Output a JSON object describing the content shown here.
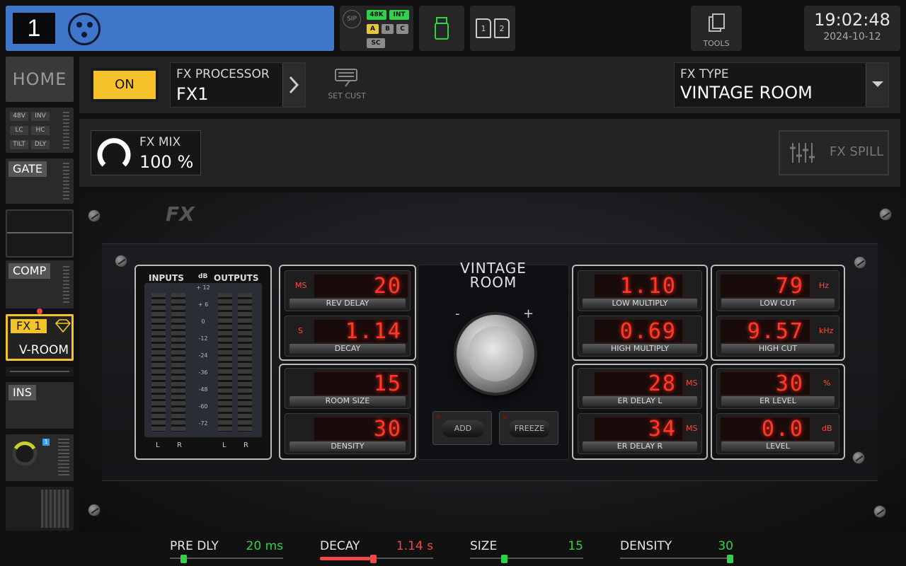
{
  "top": {
    "channel_number": "1",
    "sip_label": "SIP",
    "chips": {
      "rate": "48K",
      "clock": "INT",
      "a": "A",
      "b": "B",
      "c": "C",
      "sc": "SC"
    },
    "card1": "1",
    "card2": "2",
    "tools_label": "TOOLS",
    "time": "19:02:48",
    "date": "2024-10-12",
    "accent_color": "#3f76c9"
  },
  "sidebar": {
    "home": "HOME",
    "chips": [
      "48V",
      "INV",
      "LC",
      "HC",
      "TILT",
      "DLY"
    ],
    "gate": "GATE",
    "comp": "COMP",
    "fx_tag": "FX 1",
    "fx_name": "V-ROOM",
    "ins": "INS",
    "bus_num": "1"
  },
  "header": {
    "on_label": "ON",
    "fx_processor_label": "FX PROCESSOR",
    "fx_processor_value": "FX1",
    "set_cust": "SET CUST",
    "fx_type_label": "FX TYPE",
    "fx_type_value": "VINTAGE ROOM",
    "fx_mix_label": "FX MIX",
    "fx_mix_value": "100 %",
    "fx_spill": "FX SPILL"
  },
  "plugin": {
    "logo": "FX",
    "title_line1": "VINTAGE",
    "title_line2": "ROOM",
    "minus": "-",
    "plus": "+",
    "add": "ADD",
    "freeze": "FREEZE",
    "meter": {
      "inputs": "INPUTS",
      "db": "dB",
      "outputs": "OUTPUTS",
      "ticks": [
        "+ 12",
        "+ 6",
        "0",
        "-12",
        "-24",
        "-36",
        "-48",
        "-60",
        "-72"
      ],
      "l": "L",
      "r": "R"
    },
    "params": {
      "rev_delay": {
        "value": "20",
        "unit": "MS",
        "label": "REV DELAY"
      },
      "decay": {
        "value": "1.14",
        "unit": "S",
        "label": "DECAY"
      },
      "room_size": {
        "value": "15",
        "label": "ROOM SIZE"
      },
      "density": {
        "value": "30",
        "label": "DENSITY"
      },
      "low_multiply": {
        "value": "1.10",
        "label": "LOW MULTIPLY"
      },
      "high_multiply": {
        "value": "0.69",
        "label": "HIGH MULTIPLY"
      },
      "er_delay_l": {
        "value": "28",
        "unit": "MS",
        "label": "ER DELAY L"
      },
      "er_delay_r": {
        "value": "34",
        "unit": "MS",
        "label": "ER DELAY R"
      },
      "low_cut": {
        "value": "79",
        "unit": "Hz",
        "label": "LOW CUT"
      },
      "high_cut": {
        "value": "9.57",
        "unit": "kHz",
        "label": "HIGH CUT"
      },
      "er_level": {
        "value": "30",
        "unit": "%",
        "label": "ER LEVEL"
      },
      "level": {
        "value": "0.0",
        "unit": "dB",
        "label": "LEVEL"
      }
    }
  },
  "bottom": [
    {
      "name": "PRE DLY",
      "value": "20 ms",
      "color": "#2fd24a",
      "fill": 0.1
    },
    {
      "name": "DECAY",
      "value": "1.14 s",
      "color": "#f04848",
      "fill": 0.47
    },
    {
      "name": "SIZE",
      "value": "15",
      "color": "#2fd24a",
      "fill": 0.29
    },
    {
      "name": "DENSITY",
      "value": "30",
      "color": "#2fd24a",
      "fill": 1.0
    }
  ]
}
